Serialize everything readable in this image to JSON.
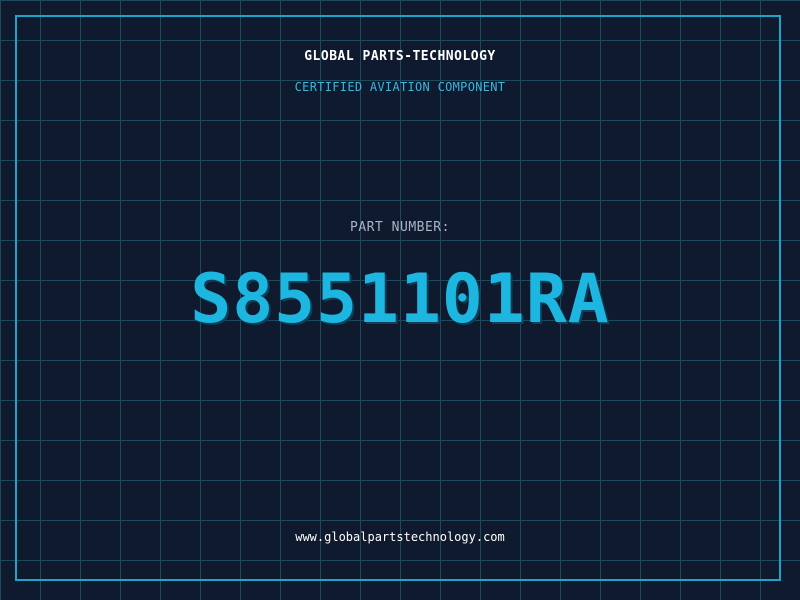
{
  "header": {
    "company_name": "GLOBAL PARTS-TECHNOLOGY",
    "tagline": "CERTIFIED AVIATION COMPONENT"
  },
  "part": {
    "label": "PART NUMBER:",
    "number": "S8551101RA"
  },
  "footer": {
    "website": "www.globalpartstechnology.com"
  },
  "colors": {
    "background": "#0f1a2e",
    "grid": "#1d4a5c",
    "frame": "#1fa3c9",
    "accent": "#1cb6e0"
  }
}
